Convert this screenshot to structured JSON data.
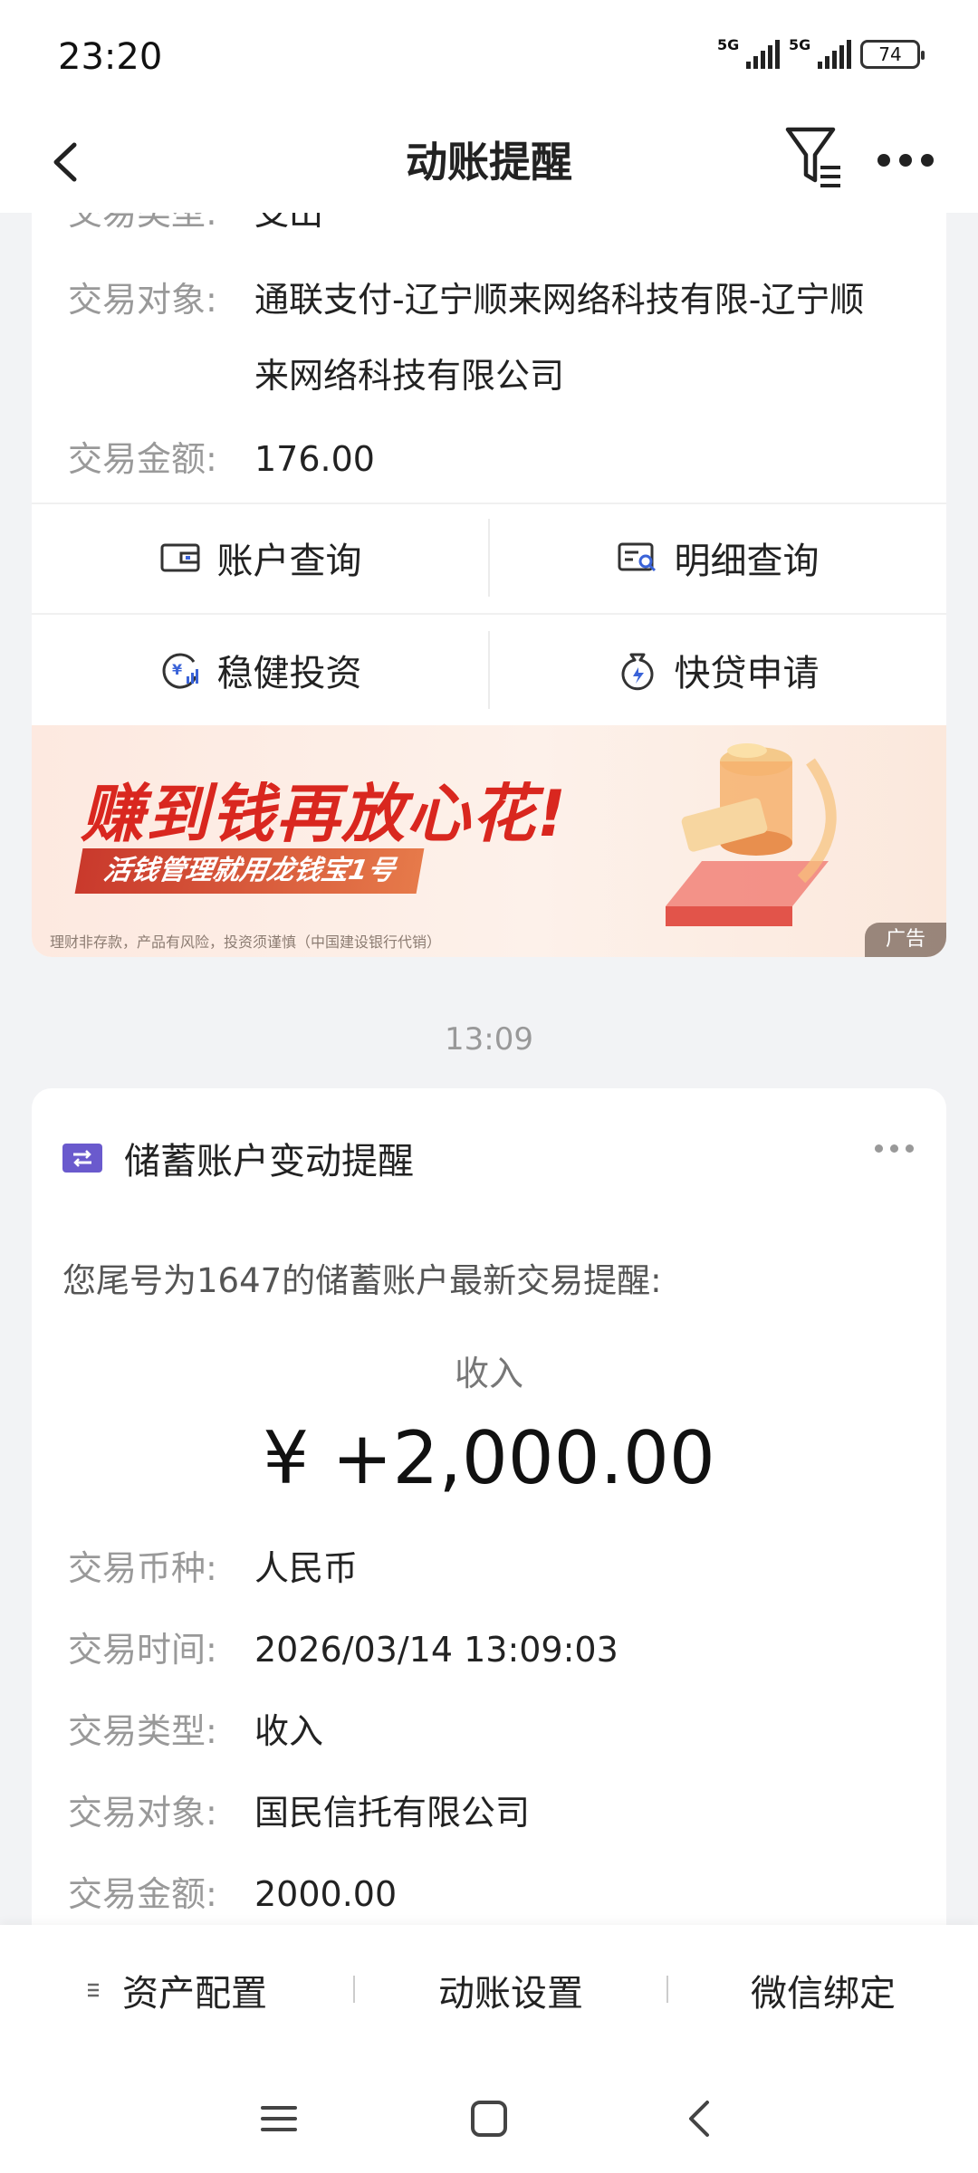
{
  "status_bar": {
    "time": "23:20",
    "signal_1_label": "5G",
    "signal_2_label": "5G",
    "battery": "74"
  },
  "nav": {
    "title": "动账提醒",
    "back_icon": "chevron-left-icon",
    "filter_icon": "filter-icon",
    "more_icon": "more-horizontal-icon"
  },
  "card1": {
    "partial_row": {
      "label": "交易类型:",
      "value": "支出"
    },
    "rows": [
      {
        "label": "交易对象:",
        "value_line1": "通联支付-辽宁顺来网络科技有限-辽宁顺",
        "value_line2": "来网络科技有限公司"
      },
      {
        "label": "交易金额:",
        "value": "176.00"
      }
    ],
    "actions": [
      {
        "label": "账户查询",
        "icon": "wallet-icon"
      },
      {
        "label": "明细查询",
        "icon": "statement-icon"
      },
      {
        "label": "稳健投资",
        "icon": "invest-icon"
      },
      {
        "label": "快贷申请",
        "icon": "loan-icon"
      }
    ],
    "banner": {
      "title": "赚到钱再放心花!",
      "subtitle": "活钱管理就用龙钱宝1号",
      "note": "理财非存款，产品有风险，投资须谨慎（中国建设银行代销）",
      "ad_label": "广告"
    }
  },
  "time_separator": "13:09",
  "card2": {
    "title": "储蓄账户变动提醒",
    "intro": "您尾号为1647的储蓄账户最新交易提醒:",
    "type": "收入",
    "amount": "¥ +2,000.00",
    "rows": [
      {
        "label": "交易币种:",
        "value": "人民币"
      },
      {
        "label": "交易时间:",
        "value": "2026/03/14 13:09:03"
      },
      {
        "label": "交易类型:",
        "value": "收入"
      },
      {
        "label": "交易对象:",
        "value": "国民信托有限公司"
      },
      {
        "label": "交易金额:",
        "value": "2000.00"
      }
    ]
  },
  "bottom_tabs": [
    {
      "label": "资产配置",
      "icon": "menu-lines-icon"
    },
    {
      "label": "动账设置"
    },
    {
      "label": "微信绑定"
    }
  ],
  "colors": {
    "banner_red": "#d9271f",
    "card_icon_purple": "#6a5acd",
    "background": "#f2f3f5"
  }
}
